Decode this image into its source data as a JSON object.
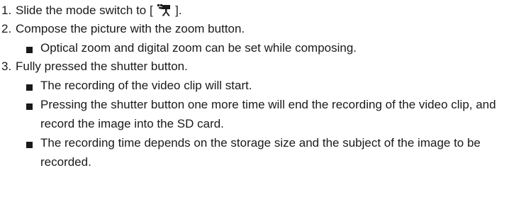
{
  "steps": [
    {
      "number": "1.",
      "text_before_icon": "Slide the mode switch to [ ",
      "icon": "video-camera-icon",
      "text_after_icon": " ].",
      "subitems": []
    },
    {
      "number": "2.",
      "text": "Compose the picture with the zoom button.",
      "subitems": [
        "Optical zoom and digital zoom can be set while composing."
      ]
    },
    {
      "number": "3.",
      "text": "Fully pressed the shutter button.",
      "subitems": [
        "The recording of the video clip will start.",
        "Pressing the shutter button one more time will end the recording of the video clip, and record the image into the SD card.",
        "The recording time depends on the storage size and the subject of the image to be recorded."
      ]
    }
  ]
}
